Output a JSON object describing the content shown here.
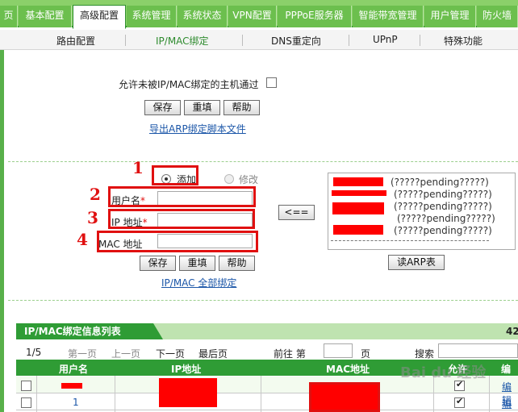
{
  "top_tabs": [
    "页",
    "基本配置",
    "高级配置",
    "系统管理",
    "系统状态",
    "VPN配置",
    "PPPoE服务器",
    "智能带宽管理",
    "用户管理",
    "防火墙"
  ],
  "active_top_tab": "高级配置",
  "sub_tabs": [
    "路由配置",
    "IP/MAC绑定",
    "DNS重定向",
    "UPnP",
    "特殊功能"
  ],
  "active_sub_tab": "IP/MAC绑定",
  "allow_unbound": {
    "label": "允许未被IP/MAC绑定的主机通过",
    "checked": false
  },
  "buttons": {
    "save": "保存",
    "reset": "重填",
    "help": "帮助",
    "move_left": "<==",
    "read_arp": "读ARP表"
  },
  "export_arp_link": "导出ARP绑定脚本文件",
  "mode": {
    "add": "添加",
    "modify": "修改",
    "selected": "添加"
  },
  "form": {
    "username_label": "用户名",
    "ip_label": "IP 地址",
    "mac_label": "MAC 地址",
    "required_mark": "*"
  },
  "annotations": [
    "1",
    "2",
    "3",
    "4"
  ],
  "arp_entries": [
    "(?????pending?????)",
    "(?????pending?????)",
    "(?????pending?????)",
    "(?????pending?????)",
    "(?????pending?????)"
  ],
  "bind_all_link": "IP/MAC 全部绑定",
  "list": {
    "title": "IP/MAC绑定信息列表",
    "count_text": "42",
    "page": "1/5",
    "first": "第一页",
    "prev": "上一页",
    "next": "下一页",
    "last": "最后页",
    "goto_prefix": "前往 第",
    "goto_suffix": "页",
    "search_label": "搜索",
    "columns": [
      "用户名",
      "IP地址",
      "MAC地址",
      "允许",
      "编辑"
    ],
    "rows": [
      {
        "username": "",
        "allow": true,
        "edit": "编辑"
      },
      {
        "username": "1",
        "allow": true,
        "edit": "编辑"
      }
    ]
  },
  "watermark": "Bai du 经验",
  "colors": {
    "accent_green": "#2f9c35",
    "annotation_red": "#e01010"
  }
}
